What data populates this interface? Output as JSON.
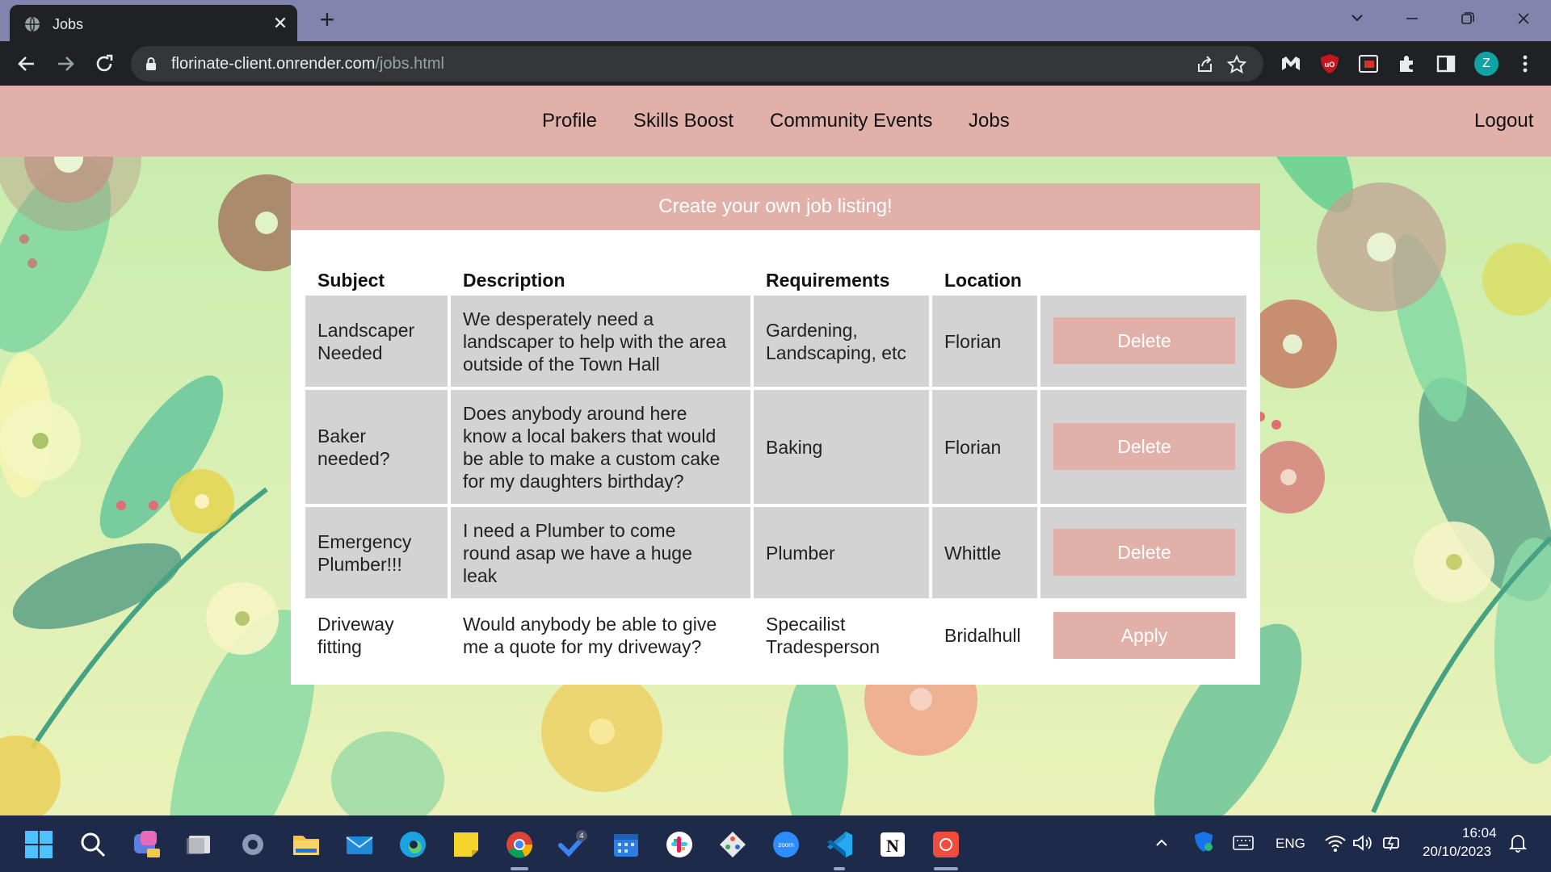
{
  "browser": {
    "tab_title": "Jobs",
    "url_domain": "florinate-client.onrender.com",
    "url_path": "/jobs.html",
    "avatar_letter": "Z"
  },
  "nav": {
    "links": [
      "Profile",
      "Skills Boost",
      "Community Events",
      "Jobs"
    ],
    "logout": "Logout"
  },
  "panel": {
    "header": "Create your own job listing!",
    "columns": [
      "Subject",
      "Description",
      "Requirements",
      "Location"
    ]
  },
  "jobs": [
    {
      "subject": [
        "Landscaper",
        "Needed"
      ],
      "description": [
        "We desperately need a",
        "landscaper to help with the area",
        "outside of the Town Hall"
      ],
      "requirements": [
        "Gardening,",
        "Landscaping, etc"
      ],
      "location": "Florian",
      "action": "Delete"
    },
    {
      "subject": [
        "Baker",
        "needed?"
      ],
      "description": [
        "Does anybody around here",
        "know a local bakers that would",
        "be able to make a custom cake",
        "for my daughters birthday?"
      ],
      "requirements": [
        "Baking"
      ],
      "location": "Florian",
      "action": "Delete"
    },
    {
      "subject": [
        "Emergency",
        "Plumber!!!"
      ],
      "description": [
        "I need a Plumber to come",
        "round asap we have a huge",
        "leak"
      ],
      "requirements": [
        "Plumber"
      ],
      "location": "Whittle",
      "action": "Delete"
    },
    {
      "subject": [
        "Driveway",
        "fitting"
      ],
      "description": [
        "Would anybody be able to give",
        "me a quote for my driveway?"
      ],
      "requirements": [
        "Specailist",
        "Tradesperson"
      ],
      "location": "Bridalhull",
      "action": "Apply"
    }
  ],
  "taskbar": {
    "language": "ENG",
    "time": "16:04",
    "date": "20/10/2023",
    "tasks_badge": "4"
  },
  "colors": {
    "accent_pink": "#e1b1a9",
    "cell_grey": "#d3d3d3",
    "chrome_dark": "#202124",
    "taskbar": "#1d2a4a"
  }
}
